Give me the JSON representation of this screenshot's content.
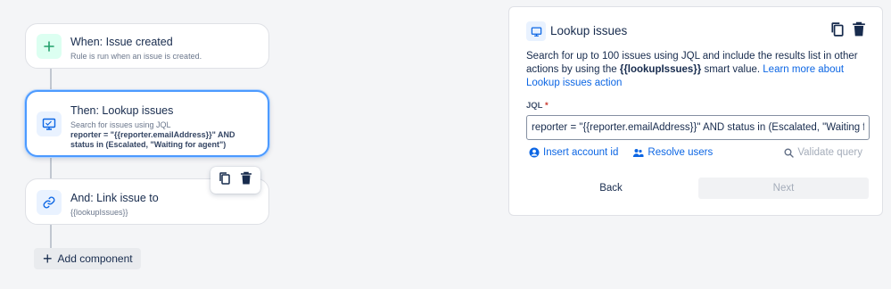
{
  "rule": {
    "trigger": {
      "title": "When: Issue created",
      "subtitle": "Rule is run when an issue is created."
    },
    "action_lookup": {
      "title": "Then: Lookup issues",
      "subtitle": "Search for issues using JQL",
      "jql_line1": "reporter = \"{{reporter.emailAddress}}\" AND",
      "jql_line2": "status in (Escalated, \"Waiting for agent\")"
    },
    "action_link": {
      "title": "And: Link issue to",
      "subtitle": "{{lookupIssues}}"
    },
    "add_component_label": "Add component"
  },
  "panel": {
    "title": "Lookup issues",
    "desc_part1": "Search for up to 100 issues using JQL and include the results list in other actions by using the ",
    "desc_bold": "{{lookupIssues}}",
    "desc_part2": " smart value. ",
    "desc_link": "Learn more about Lookup issues action",
    "jql_label": "JQL",
    "jql_required_mark": "*",
    "jql_value": "reporter = \"{{reporter.emailAddress}}\" AND status in (Escalated, \"Waiting for agent\")",
    "insert_account_label": "Insert account id",
    "resolve_users_label": "Resolve users",
    "validate_label": "Validate query",
    "back_label": "Back",
    "next_label": "Next"
  },
  "colors": {
    "link": "#0c66e4",
    "selected_border": "#4c9aff",
    "trigger_icon_bg": "#dcfff1",
    "action_icon_bg": "#e9f2ff"
  },
  "icons": {
    "trigger": "plus-icon",
    "lookup": "monitor-icon",
    "link": "link-icon",
    "copy": "copy-icon",
    "delete": "trash-icon"
  }
}
